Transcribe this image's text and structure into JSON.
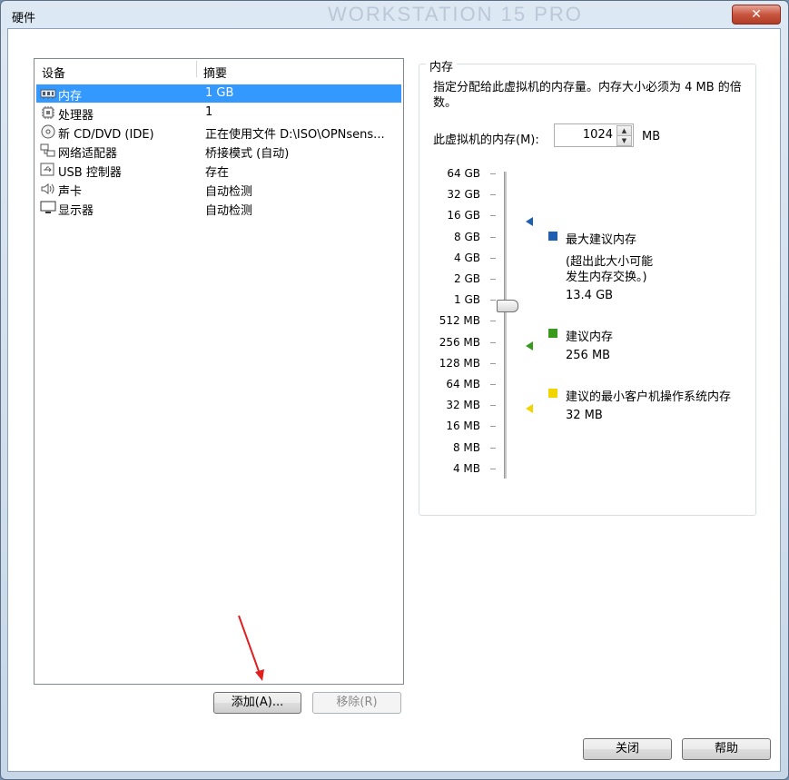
{
  "window": {
    "title": "硬件",
    "watermark": "WORKSTATION 15 PRO",
    "close_glyph": "✕"
  },
  "device_list": {
    "headers": {
      "device": "设备",
      "summary": "摘要"
    },
    "rows": [
      {
        "name": "内存",
        "summary": "1 GB",
        "icon": "memory-icon",
        "selected": true
      },
      {
        "name": "处理器",
        "summary": "1",
        "icon": "processor-icon"
      },
      {
        "name": "新 CD/DVD (IDE)",
        "summary": "正在使用文件 D:\\ISO\\OPNsens...",
        "icon": "cd-dvd-icon"
      },
      {
        "name": "网络适配器",
        "summary": "桥接模式 (自动)",
        "icon": "network-adapter-icon"
      },
      {
        "name": "USB 控制器",
        "summary": "存在",
        "icon": "usb-icon"
      },
      {
        "name": "声卡",
        "summary": "自动检测",
        "icon": "speaker-icon"
      },
      {
        "name": "显示器",
        "summary": "自动检测",
        "icon": "display-icon"
      }
    ]
  },
  "buttons": {
    "add": "添加(A)...",
    "remove": "移除(R)",
    "close": "关闭",
    "help": "帮助"
  },
  "memory": {
    "group_title": "内存",
    "description": "指定分配给此虚拟机的内存量。内存大小必须为 4 MB 的倍数。",
    "field_label": "此虚拟机的内存(M):",
    "value": "1024",
    "unit": "MB",
    "scale_labels": [
      "64 GB",
      "32 GB",
      "16 GB",
      "8 GB",
      "4 GB",
      "2 GB",
      "1 GB",
      "512 MB",
      "256 MB",
      "128 MB",
      "64 MB",
      "32 MB",
      "16 MB",
      "8 MB",
      "4 MB"
    ],
    "legend": {
      "max": {
        "title": "最大建议内存",
        "note_line1": "(超出此大小可能",
        "note_line2": "发生内存交换。)",
        "value": "13.4 GB",
        "color": "#1f5fb0"
      },
      "recommended": {
        "title": "建议内存",
        "value": "256 MB",
        "color": "#3a9a1e"
      },
      "minimum": {
        "title": "建议的最小客户机操作系统内存",
        "value": "32 MB",
        "color": "#f2d400"
      }
    }
  },
  "colors": {
    "selection": "#3399ff",
    "annotation_arrow": "#e02020"
  }
}
